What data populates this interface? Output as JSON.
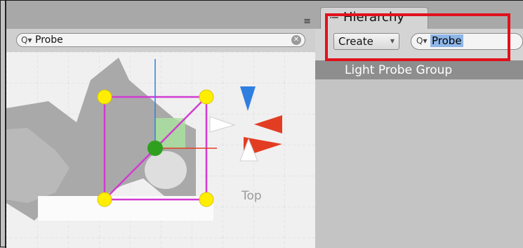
{
  "scene": {
    "search_text": "Probe",
    "view_label": "Top",
    "menu_icon": "≡",
    "search_icon": "search-dropdown-icon",
    "clear_icon": "clear-icon"
  },
  "hierarchy": {
    "tab_label": "Hierarchy",
    "tab_icon": "≔",
    "create_label": "Create",
    "search_text": "Probe",
    "items": [
      {
        "label": "Light Probe Group",
        "selected": true
      }
    ]
  },
  "colors": {
    "highlight": "#e0111b",
    "selection_bg": "#8e8e8e",
    "probe_yellow": "#ffee00",
    "bounds_magenta": "#d23bd2",
    "axis_x_red": "#e23d23",
    "axis_y_blue": "#2f7fe0",
    "pivot_green": "#2fa01e"
  }
}
